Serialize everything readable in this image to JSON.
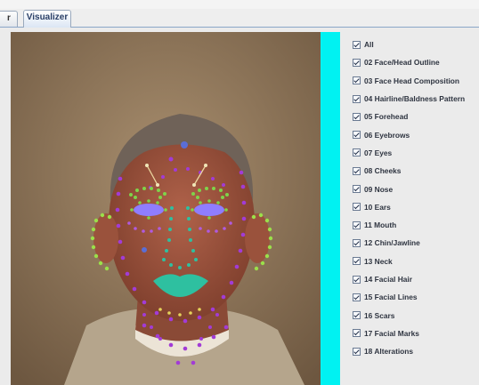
{
  "tabs": [
    {
      "label": "r",
      "active": false
    },
    {
      "label": "Visualizer",
      "active": true
    }
  ],
  "checklist": [
    {
      "label": "All",
      "checked": true
    },
    {
      "label": "02 Face/Head Outline",
      "checked": true
    },
    {
      "label": "03 Face Head Composition",
      "checked": true
    },
    {
      "label": "04 Hairline/Baldness Pattern",
      "checked": true
    },
    {
      "label": "05 Forehead",
      "checked": true
    },
    {
      "label": "06 Eyebrows",
      "checked": true
    },
    {
      "label": "07 Eyes",
      "checked": true
    },
    {
      "label": "08 Cheeks",
      "checked": true
    },
    {
      "label": "09 Nose",
      "checked": true
    },
    {
      "label": "10 Ears",
      "checked": true
    },
    {
      "label": "11 Mouth",
      "checked": true
    },
    {
      "label": "12 Chin/Jawline",
      "checked": true
    },
    {
      "label": "13 Neck",
      "checked": true
    },
    {
      "label": "14 Facial Hair",
      "checked": true
    },
    {
      "label": "15 Facial Lines",
      "checked": true
    },
    {
      "label": "16 Scars",
      "checked": true
    },
    {
      "label": "17 Facial Marks",
      "checked": true
    },
    {
      "label": "18 Alterations",
      "checked": true
    }
  ],
  "colors": {
    "divider": "#00f2f2",
    "outline_points": "#a23bd6",
    "eyebrow_points": "#7fd34a",
    "eyes_fill": "#8f7dff",
    "nose_mouth_fill": "#2ec0a0",
    "ear_points": "#9be04a"
  }
}
